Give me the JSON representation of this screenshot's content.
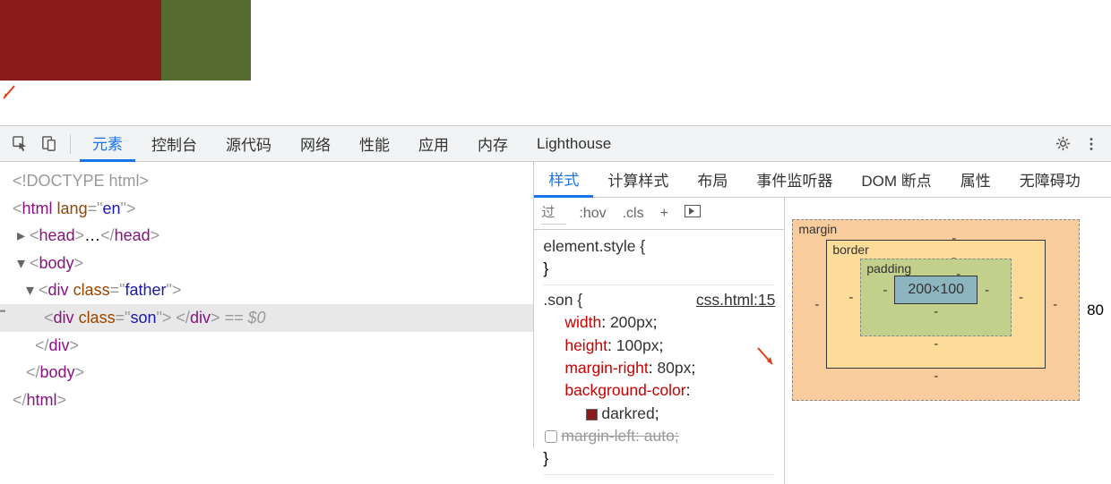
{
  "preview": {
    "father_color": "#556b2f",
    "son_color": "#8b1a1a"
  },
  "mainTabs": {
    "elements": "元素",
    "console": "控制台",
    "sources": "源代码",
    "network": "网络",
    "performance": "性能",
    "application": "应用",
    "memory": "内存",
    "lighthouse": "Lighthouse"
  },
  "dom": {
    "doctype": "<!DOCTYPE html>",
    "html_open": "<html lang=\"en\">",
    "head": "<head>…</head>",
    "body_open": "<body>",
    "father_open": "<div class=\"father\">",
    "son": "<div class=\"son\"> </div>",
    "eq0": " == $0",
    "div_close": "</div>",
    "body_close": "</body>",
    "html_close": "</html>"
  },
  "subTabs": {
    "styles": "样式",
    "computed": "计算样式",
    "layout": "布局",
    "listeners": "事件监听器",
    "dom_breakpoints": "DOM 断点",
    "properties": "属性",
    "accessibility": "无障碍功"
  },
  "stylesToolbar": {
    "filter": "过",
    "hov": ":hov",
    "cls": ".cls",
    "plus": "+"
  },
  "rules": {
    "element_style": "element.style {",
    "close_brace": "}",
    "son_selector": ".son {",
    "son_source": "css.html:15",
    "width_prop": "width",
    "width_val": "200px",
    "height_prop": "height",
    "height_val": "100px",
    "mr_prop": "margin-right",
    "mr_val": "80px",
    "bg_prop": "background-color",
    "bg_val": "darkred",
    "ml_prop": "margin-left",
    "ml_val": "auto"
  },
  "boxModel": {
    "margin_label": "margin",
    "border_label": "border",
    "padding_label": "padding",
    "content": "200×100",
    "margin_right": "80",
    "dash": "-"
  }
}
